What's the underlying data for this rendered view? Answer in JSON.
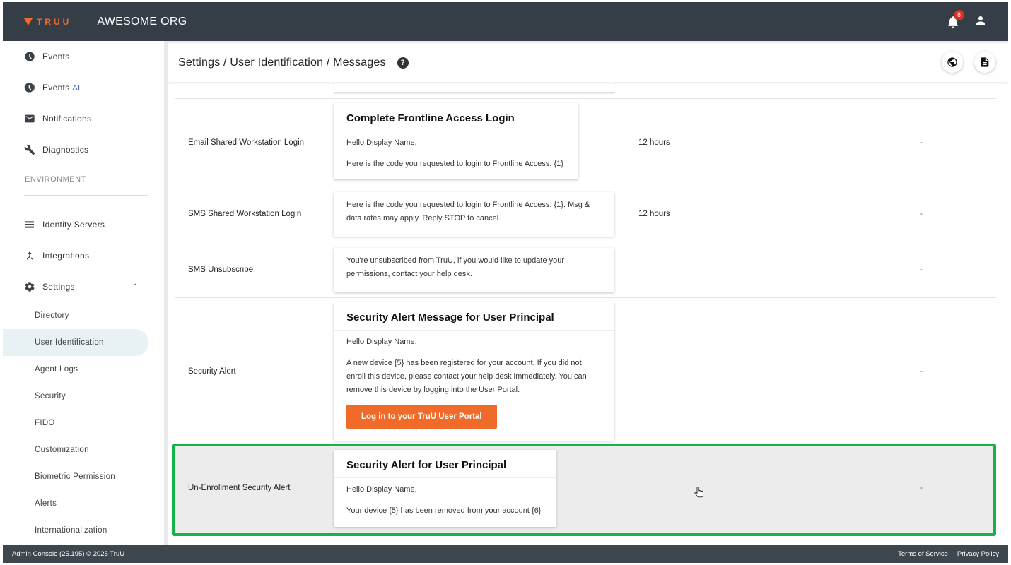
{
  "app": {
    "logo_text": "TRUU",
    "org_name": "AWESOME ORG",
    "notification_count": "8"
  },
  "sidebar": {
    "top_items": [
      {
        "label": "Events",
        "icon": "clock-icon"
      },
      {
        "label": "Events",
        "tag": "AI",
        "icon": "clock-ai-icon"
      },
      {
        "label": "Notifications",
        "icon": "mail-icon"
      },
      {
        "label": "Diagnostics",
        "icon": "wrench-icon"
      }
    ],
    "section_label": "ENVIRONMENT",
    "env_items": [
      {
        "label": "Identity Servers",
        "icon": "list-icon"
      },
      {
        "label": "Integrations",
        "icon": "merge-icon"
      },
      {
        "label": "Settings",
        "icon": "gear-icon",
        "expanded": true
      }
    ],
    "settings_subitems": [
      "Directory",
      "User Identification",
      "Agent Logs",
      "Security",
      "FIDO",
      "Customization",
      "Biometric Permission",
      "Alerts",
      "Internationalization"
    ],
    "active_subitem": "User Identification"
  },
  "header": {
    "breadcrumb": "Settings / User Identification / Messages",
    "help": "?"
  },
  "rows": [
    {
      "name": "Email Shared Workstation Login",
      "card_title": "Complete Frontline Access Login",
      "card_lines": [
        "Hello Display Name,",
        "Here is the code you requested to login to Frontline Access: {1}"
      ],
      "duration": "12 hours",
      "dash": "-"
    },
    {
      "name": "SMS Shared Workstation Login",
      "card_lines": [
        "Here is the code you requested to login to Frontline Access: {1}. Msg &",
        "data rates may apply. Reply STOP to cancel."
      ],
      "duration": "12 hours",
      "dash": "-"
    },
    {
      "name": "SMS Unsubscribe",
      "card_lines": [
        "You're unsubscribed from TruU, if you would like to update your",
        "permissions, contact your help desk."
      ],
      "duration": "",
      "dash": "-"
    },
    {
      "name": "Security Alert",
      "card_title": "Security Alert Message for User Principal",
      "card_lines": [
        "Hello Display Name,",
        "A new device {5} has been registered for your account. If you did not",
        "enroll this device, please contact your help desk immediately. You can",
        "remove this device by logging into the User Portal."
      ],
      "button": "Log in to your TruU User Portal",
      "duration": "",
      "dash": "-"
    },
    {
      "name": "Un-Enrollment Security Alert",
      "card_title": "Security Alert for User Principal",
      "card_lines": [
        "Hello Display Name,",
        "Your device {5} has been removed from your account {6}"
      ],
      "duration": "",
      "dash": "-",
      "highlighted": true
    }
  ],
  "footer": {
    "left": "Admin Console (25.195) © 2025 TruU",
    "terms": "Terms of Service",
    "privacy": "Privacy Policy"
  },
  "colors": {
    "topbar": "#353e47",
    "brand_orange": "#f06a2a",
    "highlight_border": "#16b24a",
    "active_nav": "#e8f1f3"
  }
}
